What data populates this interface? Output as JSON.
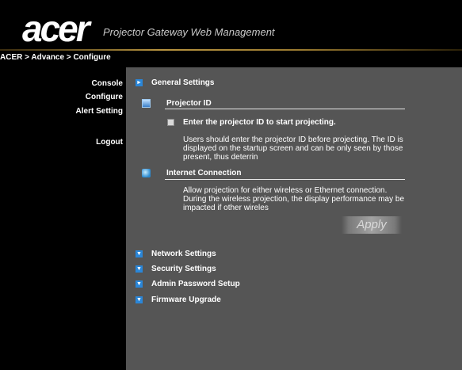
{
  "header": {
    "logo_text": "acer",
    "product_title": "Projector Gateway Web Management",
    "breadcrumb": "ACER > Advance > Configure"
  },
  "sidebar": {
    "items": [
      {
        "label": "Console"
      },
      {
        "label": "Configure"
      },
      {
        "label": "Alert Setting"
      },
      {
        "label": "Logout"
      }
    ]
  },
  "main": {
    "general_settings": {
      "label": "General Settings",
      "projector_id": {
        "title": "Projector ID",
        "checkbox_label": "Enter the projector ID to start projecting.",
        "checkbox_checked": false,
        "description": "Users should enter the projector ID before projecting. The ID is displayed on the startup screen and can be only seen by those present, thus deterrin"
      },
      "internet_connection": {
        "title": "Internet Connection",
        "description": "Allow projection for either wireless or Ethernet connection. During the wireless projection, the display performance may be impacted if other wireles"
      },
      "apply_label": "Apply"
    },
    "sections": [
      {
        "label": "Network Settings"
      },
      {
        "label": "Security Settings"
      },
      {
        "label": "Admin Password Setup"
      },
      {
        "label": "Firmware Upgrade"
      }
    ]
  },
  "colors": {
    "content_bg": "#555555",
    "accent_gold": "#b89440",
    "icon_blue": "#2a86d8"
  },
  "icons": {
    "general_settings": "arrow-right-icon",
    "collapsed_section": "arrow-down-icon",
    "projector_id": "projector-id-icon",
    "internet_connection": "network-icon"
  }
}
